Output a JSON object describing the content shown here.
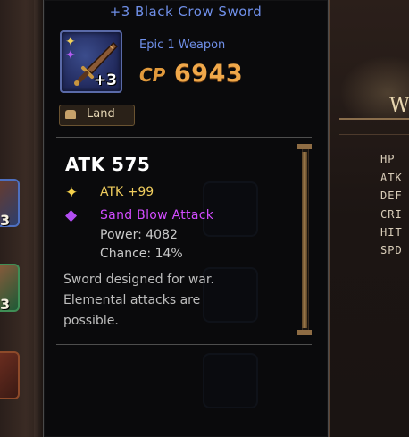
{
  "tooltip": {
    "title": "+3 Black Crow Sword",
    "item_type": "Epic 1 Weapon",
    "item_level": "+3",
    "cp_label": "CP",
    "cp_value": "6943",
    "land_label": "Land",
    "main_stat": "ATK 575",
    "bonus_attr": "ATK +99",
    "skill": {
      "name": "Sand Blow Attack",
      "power": "Power: 4082",
      "chance": "Chance: 14%"
    },
    "description": [
      "Sword designed for war.",
      "Elemental attacks are",
      "possible."
    ]
  },
  "background": {
    "left_item_levels": [
      "3",
      "3"
    ],
    "stats_labels": [
      "HP",
      "ATK",
      "DEF",
      "CRI",
      "HIT",
      "SPD"
    ],
    "emblem_text": "W"
  },
  "colors": {
    "title_blue": "#6f8fe8",
    "cp_orange": "#f0a84a",
    "attr_gold": "#f0cd5e",
    "skill_purple": "#d24cff"
  },
  "icons": {
    "item": "black-crow-sword-icon",
    "gold_star": "gold-star-icon",
    "purple_star": "purple-star-icon",
    "land": "land-icon"
  }
}
